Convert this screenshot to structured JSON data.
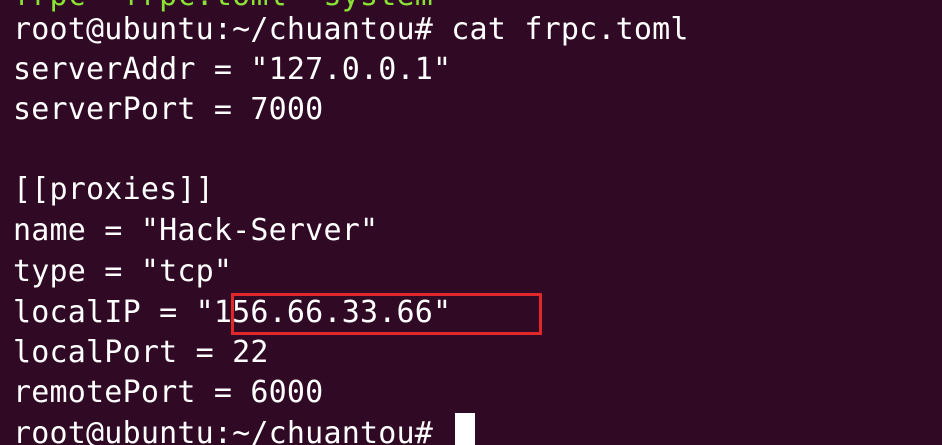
{
  "terminal": {
    "lines": [
      "frpc  frpc.toml  system",
      "root@ubuntu:~/chuantou# cat frpc.toml",
      "serverAddr = \"127.0.0.1\"",
      "serverPort = 7000",
      "",
      "[[proxies]]",
      "name = \"Hack-Server\"",
      "type = \"tcp\"",
      "localIP = \"156.66.33.66\"",
      "localPort = 22",
      "remotePort = 6000",
      "root@ubuntu:~/chuantou# "
    ],
    "highlighted_value": "\"156.66.33.66\""
  },
  "colors": {
    "background": "#300a24",
    "text": "#ffffff",
    "highlight_border": "#e0282a"
  }
}
